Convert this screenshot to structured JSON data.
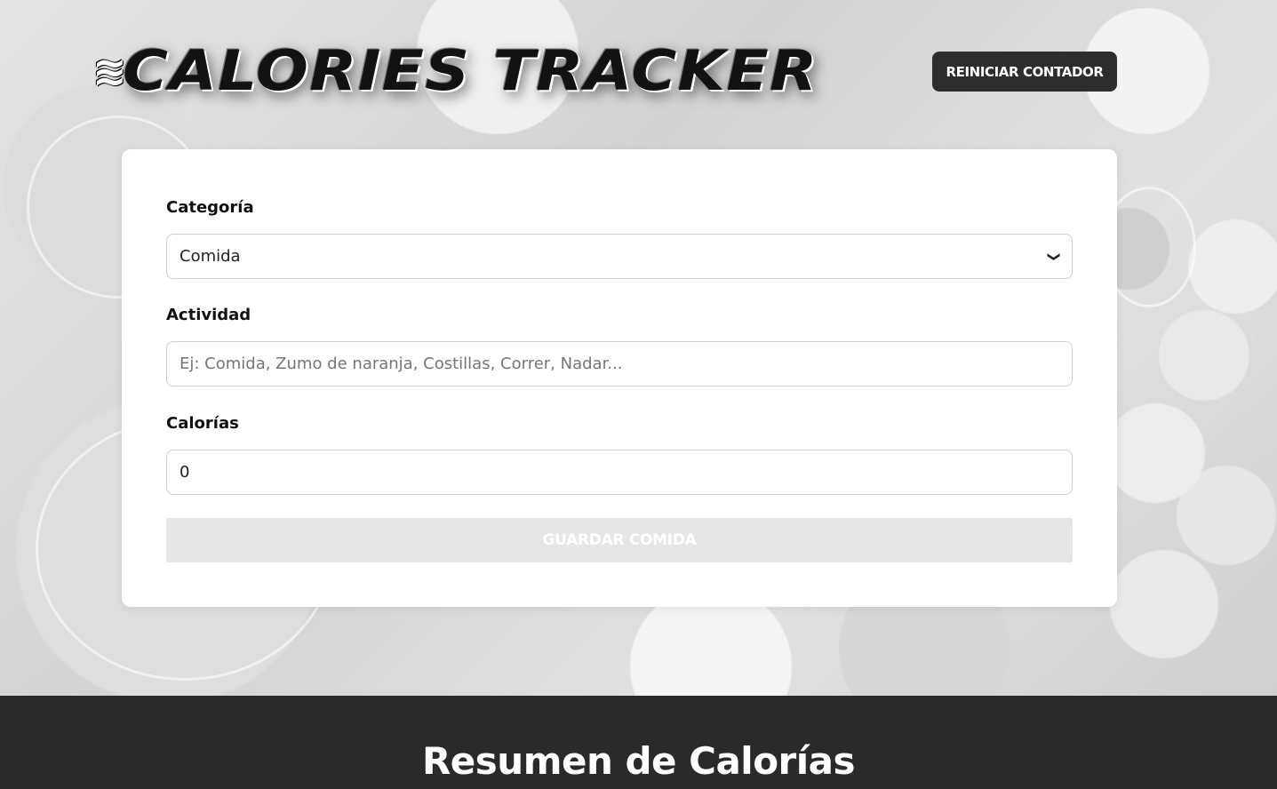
{
  "header": {
    "logo_text": "CALORIES TRACKER",
    "reset_button_label": "REINICIAR CONTADOR"
  },
  "form": {
    "category_label": "Categoría",
    "category_value": "Comida",
    "activity_label": "Actividad",
    "activity_placeholder": "Ej: Comida, Zumo de naranja, Costillas, Correr, Nadar...",
    "calories_label": "Calorías",
    "calories_value": "0",
    "submit_label": "GUARDAR COMIDA"
  },
  "summary": {
    "title": "Resumen de Calorías"
  },
  "icons": {
    "chevron": "chevron-down-icon",
    "flame": "flame-icon"
  },
  "colors": {
    "dark_button": "#2d2d2d",
    "disabled_button": "#e6e6e6",
    "footer_bg": "#2a2a2a"
  }
}
